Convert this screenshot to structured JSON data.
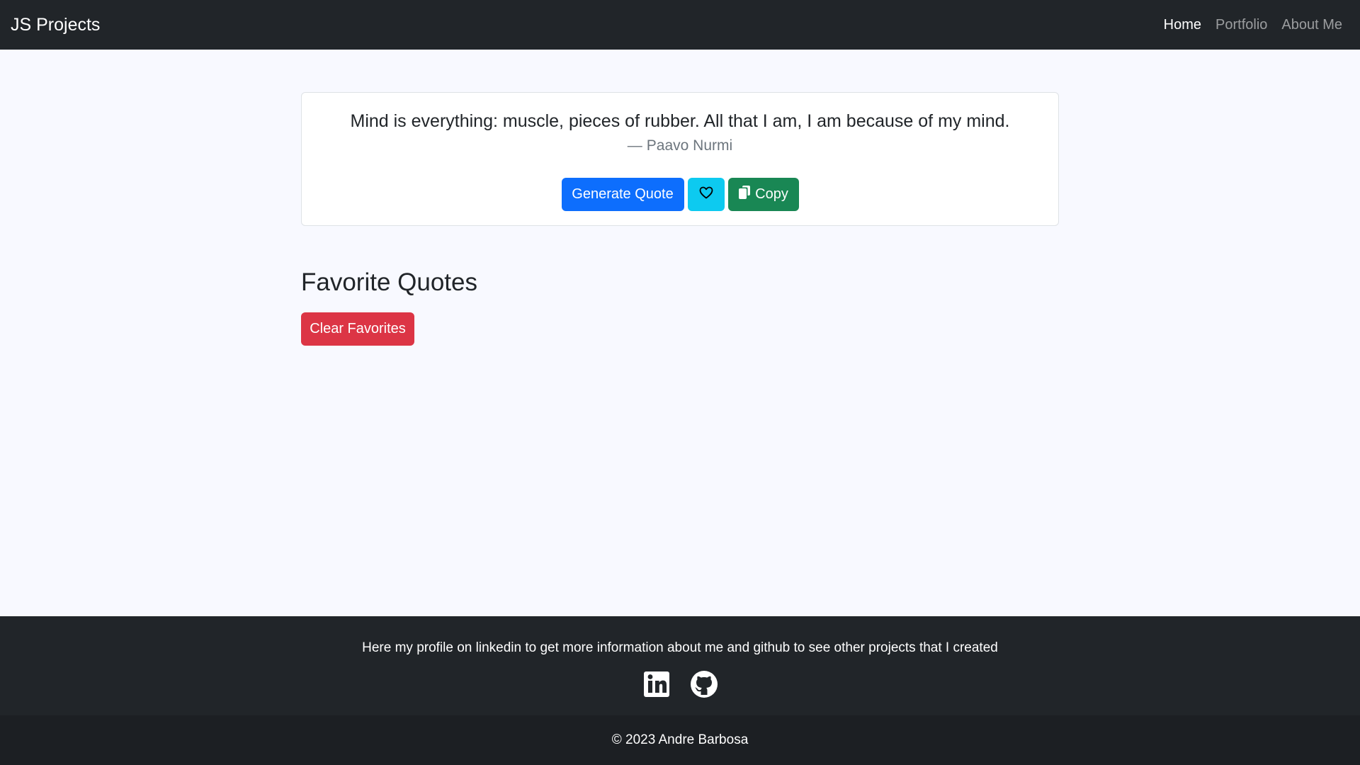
{
  "navbar": {
    "brand": "JS Projects",
    "links": [
      {
        "label": "Home",
        "active": true
      },
      {
        "label": "Portfolio",
        "active": false
      },
      {
        "label": "About Me",
        "active": false
      }
    ]
  },
  "quote": {
    "text": "Mind is everything: muscle, pieces of rubber. All that I am, I am because of my mind.",
    "author_prefix": "—",
    "author": "Paavo Nurmi",
    "buttons": {
      "generate_label": "Generate Quote",
      "favorite_icon": "heart-icon",
      "copy_icon": "copy-icon",
      "copy_label": "Copy"
    }
  },
  "favorites": {
    "title": "Favorite Quotes",
    "clear_label": "Clear Favorites"
  },
  "footer": {
    "text": "Here my profile on linkedin to get more information about me and github to see other projects that I created",
    "icons": [
      "linkedin-icon",
      "github-icon"
    ],
    "copyright": "© 2023 Andre Barbosa"
  },
  "colors": {
    "navbar_bg": "#212529",
    "page_bg": "#f8f9ff",
    "primary": "#0d6efd",
    "info": "#0dcaf0",
    "success": "#198754",
    "danger": "#dc3545",
    "copyright_bg": "#1c1f23"
  }
}
